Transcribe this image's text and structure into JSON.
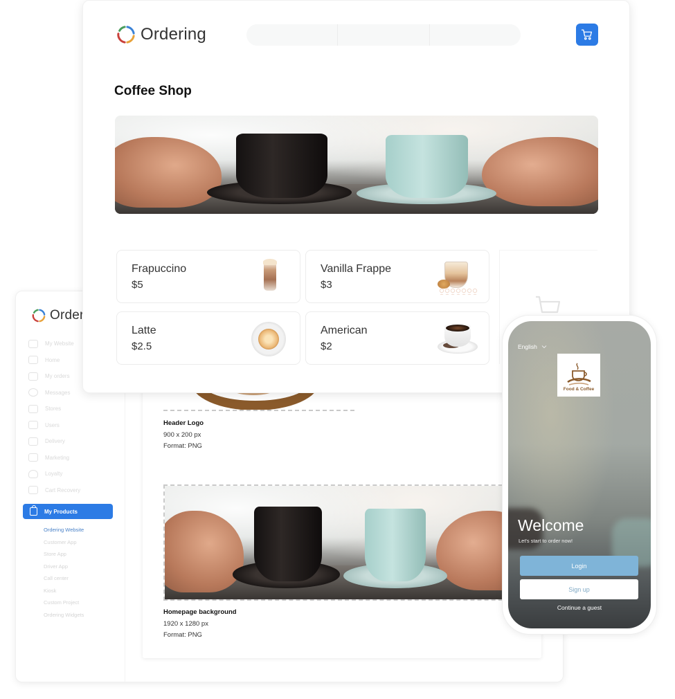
{
  "colors": {
    "primary": "#2c7be5",
    "logo_ring": [
      "#4a9e5c",
      "#3b82d6",
      "#e8a23a",
      "#c9413b"
    ],
    "phone_login_button": "#7fb4d8"
  },
  "website": {
    "brand_name": "Ordering",
    "cart_icon": "shopping-cart-icon",
    "page_title": "Coffee Shop",
    "hero_image": "coffee-cups-photo",
    "products": [
      {
        "name": "Frapuccino",
        "price": "$5",
        "image": "frapuccino-image"
      },
      {
        "name": "Vanilla Frappe",
        "price": "$3",
        "image": "vanilla-frappe-image"
      },
      {
        "name": "Latte",
        "price": "$2.5",
        "image": "latte-image"
      },
      {
        "name": "American",
        "price": "$2",
        "image": "american-coffee-image"
      }
    ]
  },
  "admin": {
    "brand_name": "Ordering",
    "nav_items": [
      {
        "label": "My Website",
        "icon": "website-icon"
      },
      {
        "label": "Home",
        "icon": "home-icon"
      },
      {
        "label": "My orders",
        "icon": "orders-icon"
      },
      {
        "label": "Messages",
        "icon": "messages-icon"
      },
      {
        "label": "Stores",
        "icon": "stores-icon"
      },
      {
        "label": "Users",
        "icon": "users-icon"
      },
      {
        "label": "Delivery",
        "icon": "delivery-icon"
      },
      {
        "label": "Marketing",
        "icon": "marketing-icon"
      },
      {
        "label": "Loyalty",
        "icon": "loyalty-icon"
      },
      {
        "label": "Cart Recovery",
        "icon": "cart-recovery-icon"
      }
    ],
    "active_section": {
      "label": "My Products",
      "icon": "shopping-bag-icon"
    },
    "sub_items": [
      {
        "label": "Ordering Website",
        "active": true
      },
      {
        "label": "Customer App",
        "active": false
      },
      {
        "label": "Store App",
        "active": false
      },
      {
        "label": "Driver App",
        "active": false
      },
      {
        "label": "Call center",
        "active": false
      },
      {
        "label": "Kiosk",
        "active": false
      },
      {
        "label": "Custom Project",
        "active": false
      },
      {
        "label": "Ordering Widgets",
        "active": false
      }
    ],
    "assets": [
      {
        "title": "Header Logo",
        "size": "900 x 200 px",
        "format": "Format: PNG"
      },
      {
        "title": "Homepage background",
        "size": "1920 x 1280 px",
        "format": "Format: PNG"
      }
    ]
  },
  "phone": {
    "language": "English",
    "brand_logo_text": "Food & Coffee",
    "welcome_title": "Welcome",
    "welcome_subtitle": "Let's start to order now!",
    "login_label": "Login",
    "signup_label": "Sign up",
    "guest_label": "Continue a guest"
  }
}
